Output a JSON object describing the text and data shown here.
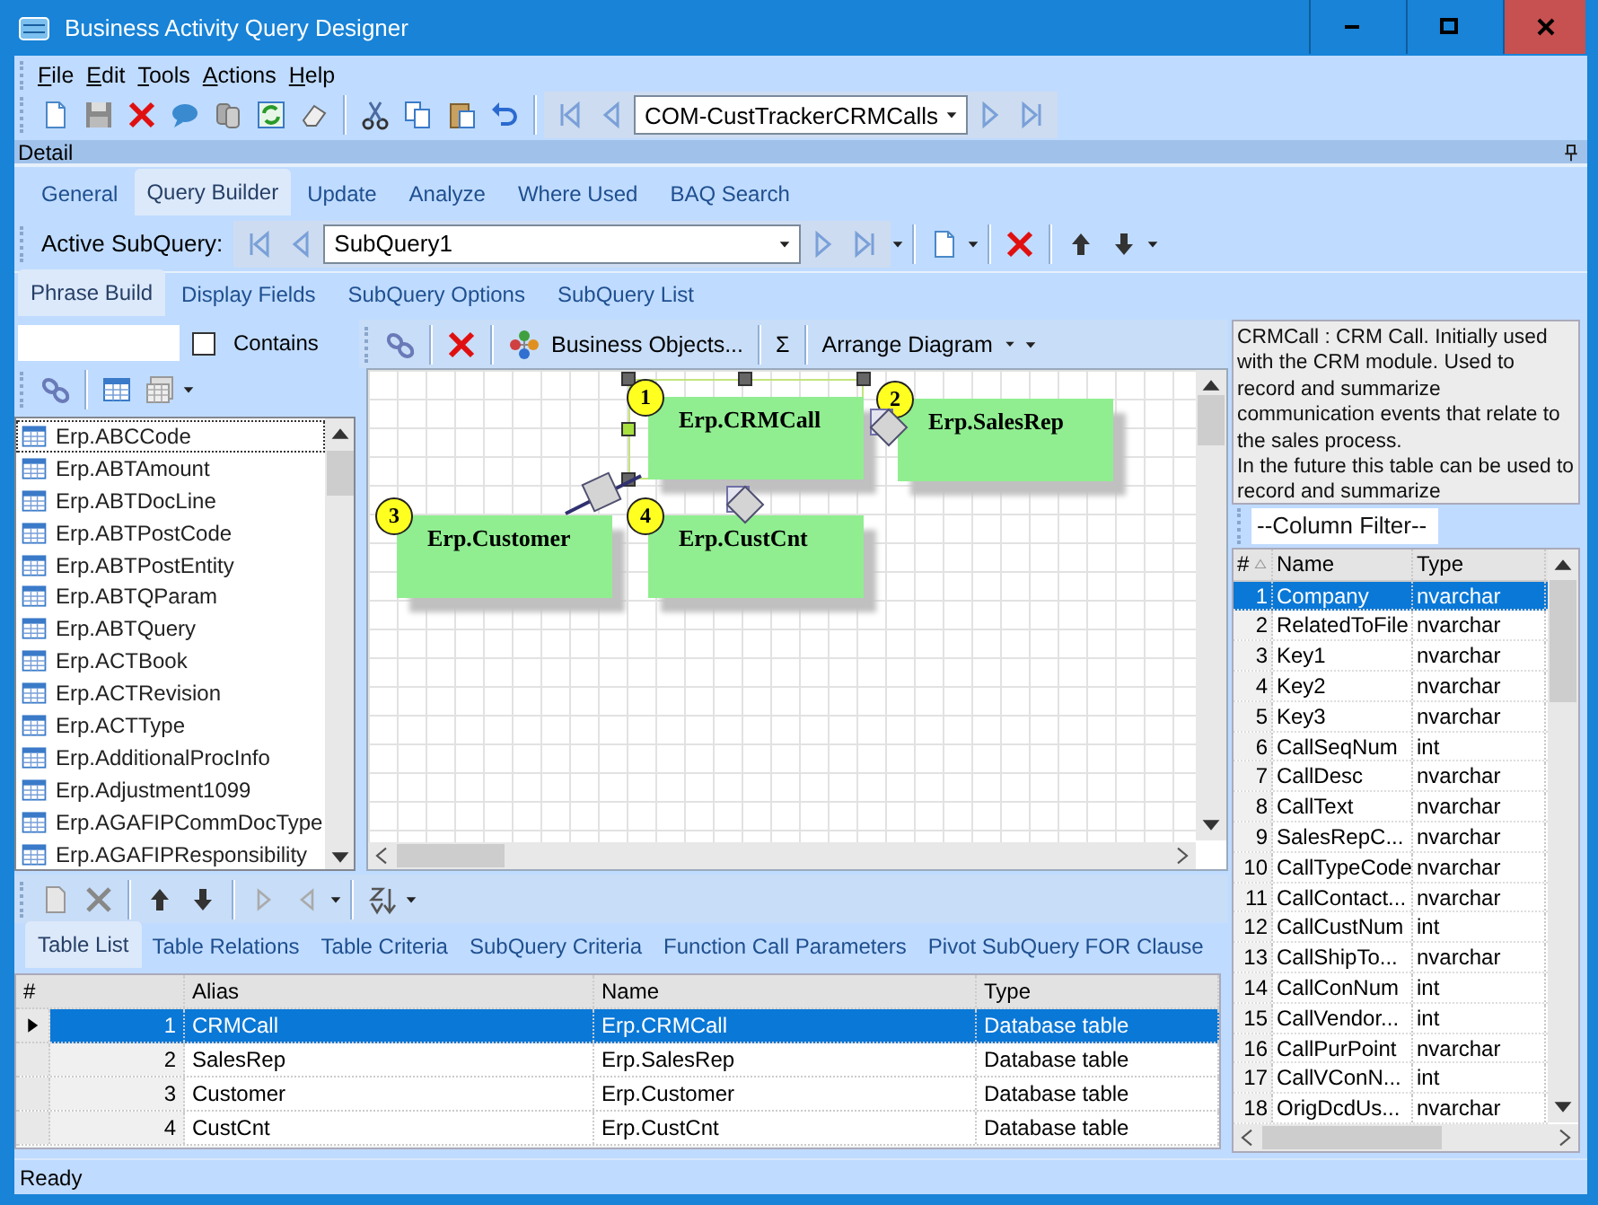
{
  "window": {
    "title": "Business Activity Query Designer"
  },
  "menu": [
    {
      "label": "File"
    },
    {
      "label": "Edit"
    },
    {
      "label": "Tools"
    },
    {
      "label": "Actions"
    },
    {
      "label": "Help"
    }
  ],
  "record_selector": {
    "value": "COM-CustTrackerCRMCalls"
  },
  "detail_panel": {
    "title": "Detail"
  },
  "tabs": [
    {
      "label": "General",
      "selected": false
    },
    {
      "label": "Query Builder",
      "selected": true
    },
    {
      "label": "Update",
      "selected": false
    },
    {
      "label": "Analyze",
      "selected": false
    },
    {
      "label": "Where Used",
      "selected": false
    },
    {
      "label": "BAQ Search",
      "selected": false
    }
  ],
  "subquery_bar": {
    "label": "Active SubQuery:",
    "value": "SubQuery1"
  },
  "subquery_tabs": [
    {
      "label": "Phrase Build",
      "selected": true
    },
    {
      "label": "Display Fields",
      "selected": false
    },
    {
      "label": "SubQuery Options",
      "selected": false
    },
    {
      "label": "SubQuery List",
      "selected": false
    }
  ],
  "table_browser": {
    "contains": {
      "label": "Contains",
      "checked": false
    },
    "items": [
      {
        "label": "Erp.ABCCode",
        "focused": true
      },
      {
        "label": "Erp.ABTAmount",
        "focused": false
      },
      {
        "label": "Erp.ABTDocLine",
        "focused": false
      },
      {
        "label": "Erp.ABTPostCode",
        "focused": false
      },
      {
        "label": "Erp.ABTPostEntity",
        "focused": false
      },
      {
        "label": "Erp.ABTQParam",
        "focused": false
      },
      {
        "label": "Erp.ABTQuery",
        "focused": false
      },
      {
        "label": "Erp.ACTBook",
        "focused": false
      },
      {
        "label": "Erp.ACTRevision",
        "focused": false
      },
      {
        "label": "Erp.ACTType",
        "focused": false
      },
      {
        "label": "Erp.AdditionalProcInfo",
        "focused": false
      },
      {
        "label": "Erp.Adjustment1099",
        "focused": false
      },
      {
        "label": "Erp.AGAFIPCommDocType",
        "focused": false
      },
      {
        "label": "Erp.AGAFIPResponsibility",
        "focused": false
      }
    ]
  },
  "diagram_toolbar": {
    "business_objects": "Business Objects...",
    "sum": "Σ",
    "arrange": "Arrange Diagram"
  },
  "diagram": {
    "nodes": [
      {
        "number": "1",
        "name": "Erp.CRMCall",
        "selected": true
      },
      {
        "number": "2",
        "name": "Erp.SalesRep",
        "selected": false
      },
      {
        "number": "3",
        "name": "Erp.Customer",
        "selected": false
      },
      {
        "number": "4",
        "name": "Erp.CustCnt",
        "selected": false
      }
    ]
  },
  "table_description": [
    "CRMCall : CRM Call.  Initially used with the CRM module.  Used to record and summarize communication events that relate to the sales process.",
    "In the future this table can be used to record and summarize"
  ],
  "column_filter": {
    "placeholder": "--Column Filter--"
  },
  "columns_grid": {
    "columns": [
      "#",
      "Name",
      "Type"
    ],
    "rows": [
      {
        "number": "1",
        "name": "Company",
        "type": "nvarchar",
        "selected": true
      },
      {
        "number": "2",
        "name": "RelatedToFile",
        "type": "nvarchar",
        "selected": false
      },
      {
        "number": "3",
        "name": "Key1",
        "type": "nvarchar",
        "selected": false
      },
      {
        "number": "4",
        "name": "Key2",
        "type": "nvarchar",
        "selected": false
      },
      {
        "number": "5",
        "name": "Key3",
        "type": "nvarchar",
        "selected": false
      },
      {
        "number": "6",
        "name": "CallSeqNum",
        "type": "int",
        "selected": false
      },
      {
        "number": "7",
        "name": "CallDesc",
        "type": "nvarchar",
        "selected": false
      },
      {
        "number": "8",
        "name": "CallText",
        "type": "nvarchar",
        "selected": false
      },
      {
        "number": "9",
        "name": "SalesRepC...",
        "type": "nvarchar",
        "selected": false
      },
      {
        "number": "10",
        "name": "CallTypeCode",
        "type": "nvarchar",
        "selected": false
      },
      {
        "number": "11",
        "name": "CallContact...",
        "type": "nvarchar",
        "selected": false
      },
      {
        "number": "12",
        "name": "CallCustNum",
        "type": "int",
        "selected": false
      },
      {
        "number": "13",
        "name": "CallShipTo...",
        "type": "nvarchar",
        "selected": false
      },
      {
        "number": "14",
        "name": "CallConNum",
        "type": "int",
        "selected": false
      },
      {
        "number": "15",
        "name": "CallVendor...",
        "type": "int",
        "selected": false
      },
      {
        "number": "16",
        "name": "CallPurPoint",
        "type": "nvarchar",
        "selected": false
      },
      {
        "number": "17",
        "name": "CallVConN...",
        "type": "int",
        "selected": false
      },
      {
        "number": "18",
        "name": "OrigDcdUs...",
        "type": "nvarchar",
        "selected": false
      }
    ]
  },
  "bottom_tabs": [
    {
      "label": "Table List",
      "selected": true
    },
    {
      "label": "Table Relations",
      "selected": false
    },
    {
      "label": "Table Criteria",
      "selected": false
    },
    {
      "label": "SubQuery Criteria",
      "selected": false
    },
    {
      "label": "Function Call Parameters",
      "selected": false
    },
    {
      "label": "Pivot SubQuery FOR Clause",
      "selected": false
    }
  ],
  "table_list": {
    "columns": [
      "#",
      "Alias",
      "Name",
      "Type"
    ],
    "rows": [
      {
        "number": "1",
        "alias": "CRMCall",
        "name": "Erp.CRMCall",
        "type": "Database table",
        "selected": true
      },
      {
        "number": "2",
        "alias": "SalesRep",
        "name": "Erp.SalesRep",
        "type": "Database table",
        "selected": false
      },
      {
        "number": "3",
        "alias": "Customer",
        "name": "Erp.Customer",
        "type": "Database table",
        "selected": false
      },
      {
        "number": "4",
        "alias": "CustCnt",
        "name": "Erp.CustCnt",
        "type": "Database table",
        "selected": false
      }
    ]
  },
  "status_bar": {
    "text": "Ready"
  }
}
